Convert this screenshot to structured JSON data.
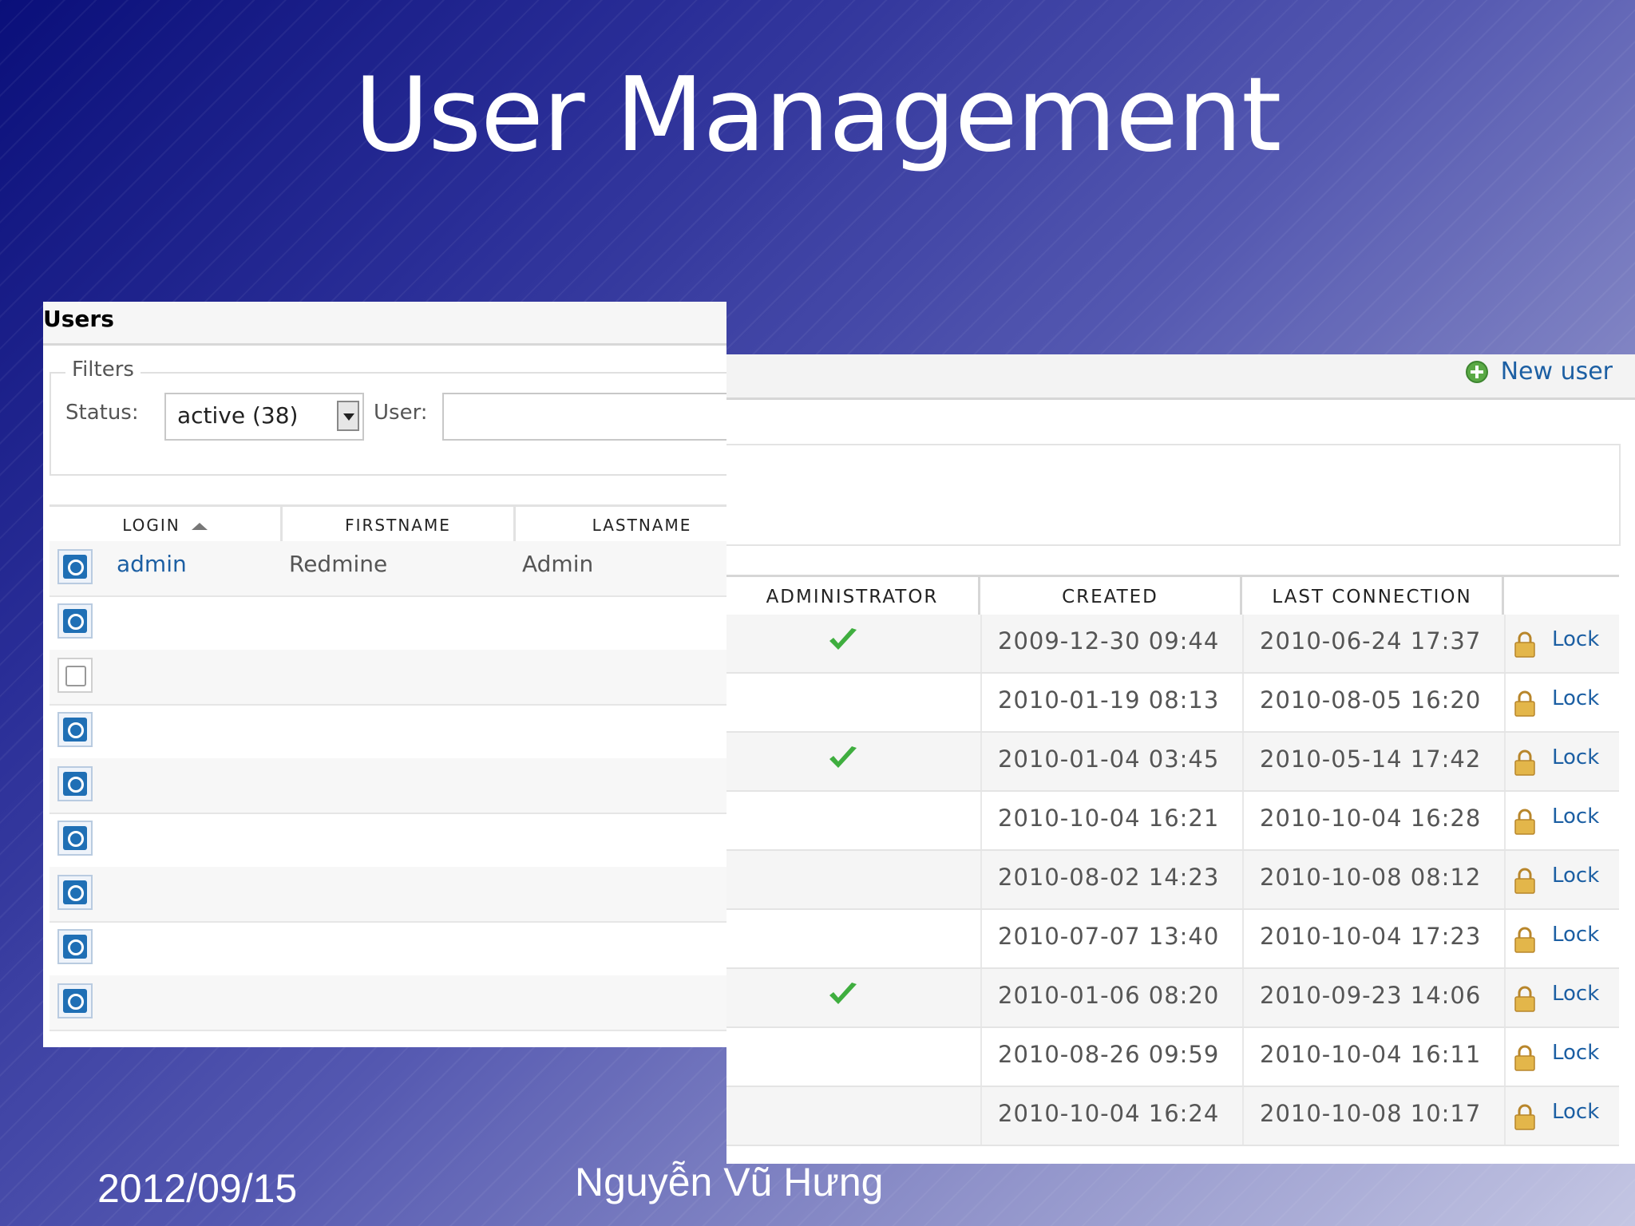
{
  "slide": {
    "title": "User Management",
    "date": "2012/09/15",
    "author": "Nguyễn Vũ Hưng"
  },
  "left_panel": {
    "header": "Users",
    "filters": {
      "legend": "Filters",
      "status_label": "Status:",
      "status_value": "active (38)",
      "user_label": "User:",
      "user_value": ""
    },
    "columns": [
      "LOGIN",
      "FIRSTNAME",
      "LASTNAME"
    ],
    "rows": [
      {
        "login": "admin",
        "firstname": "Redmine",
        "lastname": "Admin",
        "icon": "user-active-icon"
      },
      {
        "login": "",
        "firstname": "",
        "lastname": "",
        "icon": "user-active-icon"
      },
      {
        "login": "",
        "firstname": "",
        "lastname": "",
        "icon": "user-image-icon"
      },
      {
        "login": "",
        "firstname": "",
        "lastname": "",
        "icon": "user-active-icon"
      },
      {
        "login": "",
        "firstname": "",
        "lastname": "",
        "icon": "user-active-icon"
      },
      {
        "login": "",
        "firstname": "",
        "lastname": "",
        "icon": "user-active-icon"
      },
      {
        "login": "",
        "firstname": "",
        "lastname": "",
        "icon": "user-active-icon"
      },
      {
        "login": "",
        "firstname": "",
        "lastname": "",
        "icon": "user-active-icon"
      },
      {
        "login": "",
        "firstname": "",
        "lastname": "",
        "icon": "user-active-icon"
      }
    ]
  },
  "right_panel": {
    "new_user_label": "New user",
    "columns": [
      "ADMINISTRATOR",
      "CREATED",
      "LAST CONNECTION",
      ""
    ],
    "rows": [
      {
        "admin": true,
        "created": "2009-12-30 09:44",
        "last_connection": "2010-06-24 17:37",
        "action": "Lock"
      },
      {
        "admin": false,
        "created": "2010-01-19 08:13",
        "last_connection": "2010-08-05 16:20",
        "action": "Lock"
      },
      {
        "admin": true,
        "created": "2010-01-04 03:45",
        "last_connection": "2010-05-14 17:42",
        "action": "Lock"
      },
      {
        "admin": false,
        "created": "2010-10-04 16:21",
        "last_connection": "2010-10-04 16:28",
        "action": "Lock"
      },
      {
        "admin": false,
        "created": "2010-08-02 14:23",
        "last_connection": "2010-10-08 08:12",
        "action": "Lock"
      },
      {
        "admin": false,
        "created": "2010-07-07 13:40",
        "last_connection": "2010-10-04 17:23",
        "action": "Lock"
      },
      {
        "admin": true,
        "created": "2010-01-06 08:20",
        "last_connection": "2010-09-23 14:06",
        "action": "Lock"
      },
      {
        "admin": false,
        "created": "2010-08-26 09:59",
        "last_connection": "2010-10-04 16:11",
        "action": "Lock"
      },
      {
        "admin": false,
        "created": "2010-10-04 16:24",
        "last_connection": "2010-10-08 10:17",
        "action": "Lock"
      }
    ]
  },
  "colors": {
    "link": "#1c5fa3",
    "check": "#3fae3f",
    "lock": "#e3b64a",
    "user_icon": "#1f6fb5"
  }
}
